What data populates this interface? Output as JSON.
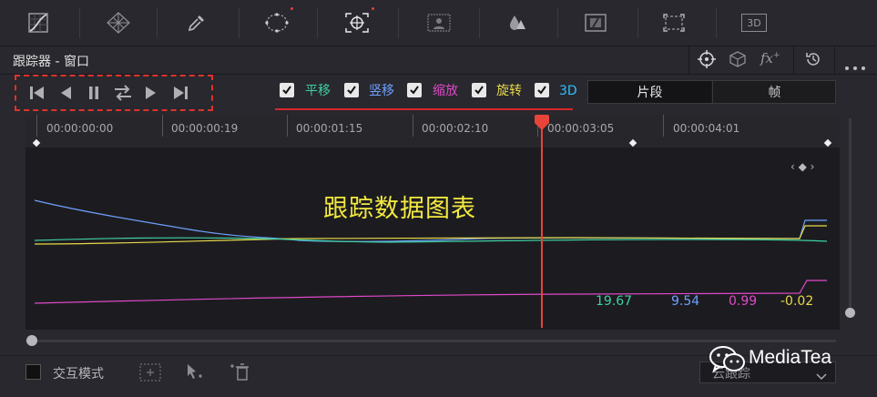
{
  "toolbar": {
    "icons": [
      "curves-icon",
      "color-warper-icon",
      "qualifier-icon",
      "window-icon",
      "tracker-icon",
      "magic-mask-icon",
      "blur-icon",
      "key-icon",
      "sizing-icon",
      "3d-icon"
    ],
    "three_d_label": "3D"
  },
  "panel": {
    "title": "跟踪器 - 窗口",
    "right_icons": [
      "crosshair-icon",
      "cube-icon",
      "fx-icon",
      "reset-icon",
      "more-icon"
    ],
    "fx_label": "fx"
  },
  "track_options": {
    "pan": {
      "label": "平移",
      "checked": true,
      "color": "#3fd0a0"
    },
    "tilt": {
      "label": "竖移",
      "checked": true,
      "color": "#6fa0ff"
    },
    "zoom": {
      "label": "缩放",
      "checked": true,
      "color": "#e048c8"
    },
    "rotate": {
      "label": "旋转",
      "checked": true,
      "color": "#e8d84a"
    },
    "three_d": {
      "label": "3D",
      "checked": true,
      "color": "#2ec0ff"
    }
  },
  "view_mode": {
    "clip": "片段",
    "frame": "帧",
    "selected": "clip"
  },
  "ruler": {
    "timecodes": [
      "00:00:00:00",
      "00:00:00:19",
      "00:00:01:15",
      "00:00:02:10",
      "00:00:03:05",
      "00:00:04:01"
    ]
  },
  "graph": {
    "title": "跟踪数据图表",
    "keyframe_nav": "‹ ◆ ›",
    "values": {
      "pan": "19.67",
      "tilt": "9.54",
      "zoom": "0.99",
      "rotate": "-0.02"
    },
    "playhead_color": "#e8443a"
  },
  "bottom": {
    "interactive_mode_label": "交互模式",
    "interactive_mode_checked": false,
    "cloud_tracker_label": "云跟踪"
  },
  "watermark": "MediaTea"
}
